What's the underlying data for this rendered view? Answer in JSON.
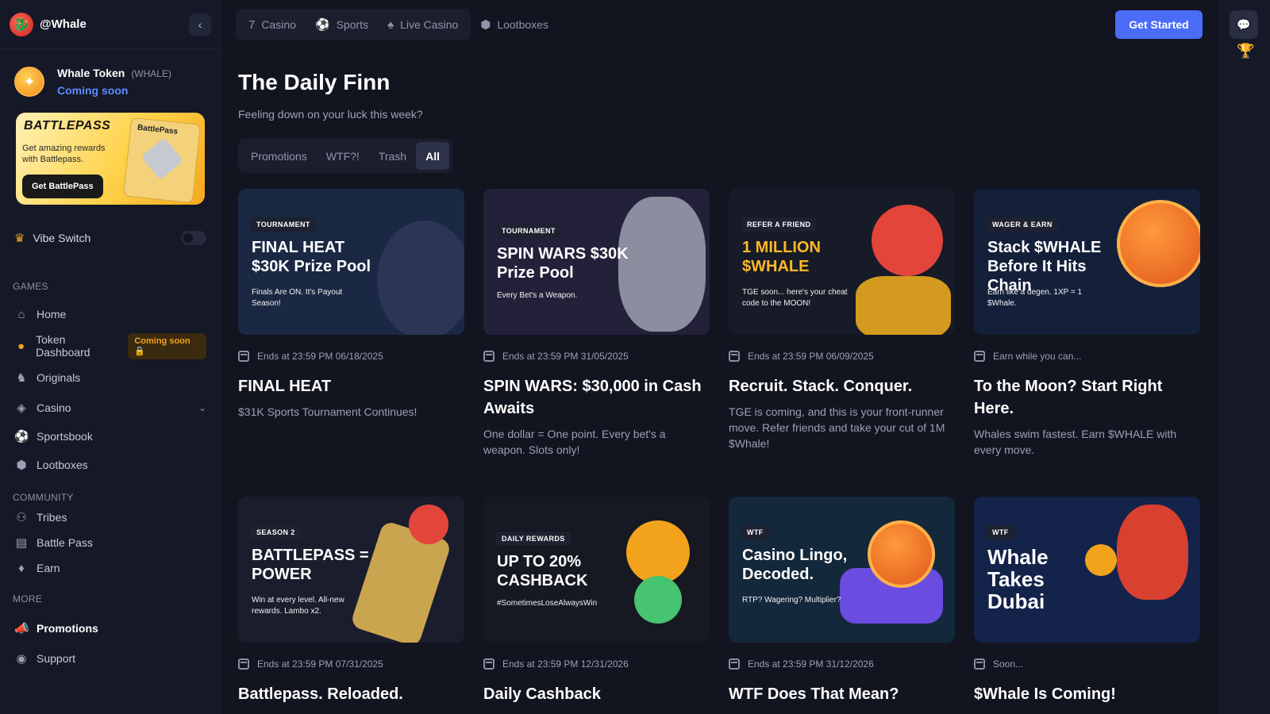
{
  "brand": {
    "name": "@Whale"
  },
  "token": {
    "name": "Whale Token",
    "symbol": "(WHALE)",
    "status": "Coming soon"
  },
  "battlepass": {
    "title": "BATTLEPASS",
    "description": "Get amazing rewards with Battlepass.",
    "button": "Get BattlePass",
    "card_label": "BattlePass"
  },
  "vibe": {
    "label": "Vibe Switch"
  },
  "sidebar": {
    "games_label": "GAMES",
    "games": [
      {
        "label": "Home",
        "icon": "home-icon"
      },
      {
        "label": "Token Dashboard",
        "icon": "token-icon",
        "badge": "Coming soon"
      },
      {
        "label": "Originals",
        "icon": "originals-icon"
      },
      {
        "label": "Casino",
        "icon": "casino-icon"
      },
      {
        "label": "Sportsbook",
        "icon": "sportsbook-icon"
      },
      {
        "label": "Lootboxes",
        "icon": "lootbox-icon"
      }
    ],
    "community_label": "COMMUNITY",
    "community": [
      {
        "label": "Tribes",
        "icon": "tribes-icon"
      },
      {
        "label": "Battle Pass",
        "icon": "battle-pass-icon"
      },
      {
        "label": "Earn",
        "icon": "earn-icon"
      }
    ],
    "more_label": "MORE",
    "more": [
      {
        "label": "Promotions",
        "icon": "megaphone-icon"
      },
      {
        "label": "Support",
        "icon": "support-icon"
      }
    ]
  },
  "topnav": {
    "items": [
      "Casino",
      "Sports",
      "Live Casino",
      "Lootboxes"
    ],
    "cta": "Get Started"
  },
  "page": {
    "title": "The Daily Finn",
    "subtitle": "Feeling down on your luck this week?"
  },
  "filters": [
    "Promotions",
    "WTF?!",
    "Trash",
    "All"
  ],
  "filters_active": "All",
  "cards": [
    {
      "tag": "TOURNAMENT",
      "headline": "FINAL HEAT $30K Prize Pool",
      "subline": "Finals Are ON. It's Payout Season!",
      "meta": "Ends at 23:59 PM 06/18/2025",
      "title": "FINAL HEAT",
      "desc": "$31K Sports Tournament Continues!",
      "bg": "#1a2844"
    },
    {
      "tag": "TOURNAMENT",
      "headline": "SPIN WARS $30K Prize Pool",
      "subline": "Every Bet's a Weapon.",
      "meta": "Ends at 23:59 PM 31/05/2025",
      "title": "SPIN WARS: $30,000 in Cash Awaits",
      "desc": "One dollar = One point. Every bet's a weapon. Slots only!",
      "bg": "#23213a"
    },
    {
      "tag": "REFER A FRIEND",
      "headline": "1 MILLION $WHALE",
      "subline": "TGE soon... here's your cheat code to the MOON!",
      "meta": "Ends at 23:59 PM 06/09/2025",
      "title": "Recruit. Stack. Conquer.",
      "desc": "TGE is coming, and this is your front-runner move. Refer friends and take your cut of 1M $Whale!",
      "bg": "#171a27"
    },
    {
      "tag": "WAGER & EARN",
      "headline": "Stack $WHALE Before It Hits Chain",
      "subline": "Earn like a degen. 1XP = 1 $Whale.",
      "meta": "Earn while you can...",
      "title": "To the Moon? Start Right Here.",
      "desc": "Whales swim fastest. Earn $WHALE with every move.",
      "bg": "#14203a"
    },
    {
      "tag": "SEASON 2",
      "headline": "BATTLEPASS = POWER",
      "subline": "Win at every level. All-new rewards. Lambo x2.",
      "meta": "Ends at 23:59 PM 07/31/2025",
      "title": "Battlepass. Reloaded.",
      "desc": "",
      "bg": "#1a1d2c"
    },
    {
      "tag": "DAILY REWARDS",
      "headline": "UP TO 20% CASHBACK",
      "subline": "#SometimesLoseAlwaysWin",
      "meta": "Ends at 23:59 PM 12/31/2026",
      "title": "Daily Cashback",
      "desc": "",
      "bg": "#161822"
    },
    {
      "tag": "WTF",
      "headline": "Casino Lingo, Decoded.",
      "subline": "RTP? Wagering? Multiplier?",
      "meta": "Ends at 23:59 PM 31/12/2026",
      "title": "WTF Does That Mean?",
      "desc": "",
      "bg": "#14283c"
    },
    {
      "tag": "WTF",
      "headline": "Whale Takes Dubai",
      "subline": "",
      "meta": "Soon...",
      "title": "$Whale Is Coming!",
      "desc": "",
      "bg": "#13234a"
    }
  ]
}
